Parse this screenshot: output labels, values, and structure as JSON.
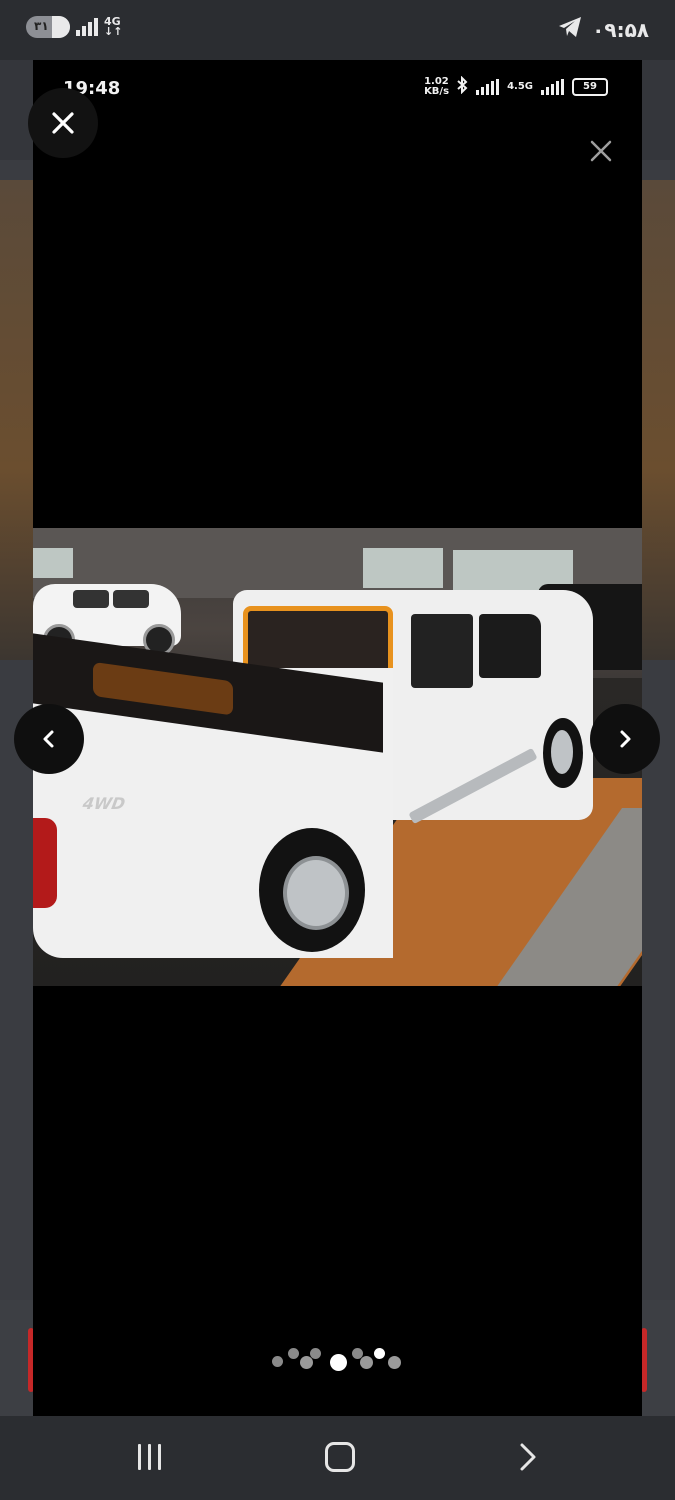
{
  "status_bar": {
    "time": "۰۹:۵۸",
    "battery_level": "۳۱",
    "network": "4G",
    "icons": [
      "battery-icon",
      "signal-icon",
      "network-4g-icon",
      "telegram-icon"
    ]
  },
  "viewer": {
    "embedded_status": {
      "time": "19:48",
      "data_rate": "1.02 KB/s",
      "network": "4.5G",
      "battery": "59"
    },
    "image": {
      "badge_text": "4WD"
    },
    "pagination": {
      "count": 9,
      "active_index": 4
    }
  },
  "icons": {
    "close_main": "close-icon",
    "close_inner": "close-icon",
    "prev": "chevron-left-icon",
    "next": "chevron-right-icon"
  },
  "android_nav": {
    "buttons": [
      "recents-icon",
      "home-icon",
      "back-icon"
    ]
  }
}
